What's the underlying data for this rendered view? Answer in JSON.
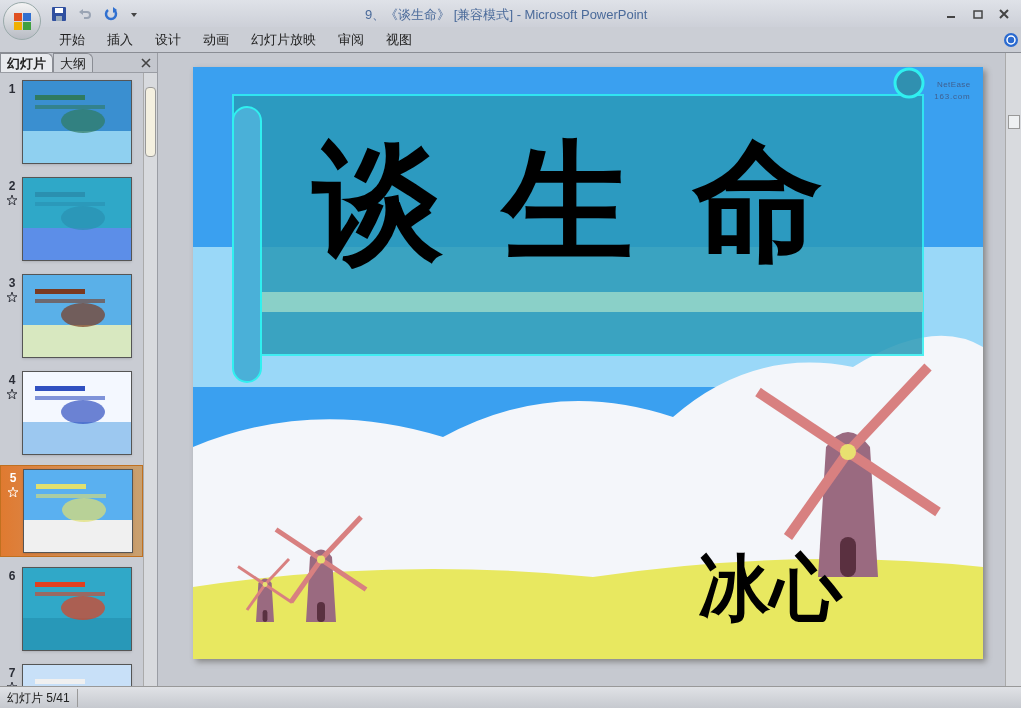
{
  "window": {
    "title": "9、《谈生命》 [兼容模式] - Microsoft PowerPoint"
  },
  "ribbon_tabs": [
    {
      "label": "开始"
    },
    {
      "label": "插入"
    },
    {
      "label": "设计"
    },
    {
      "label": "动画"
    },
    {
      "label": "幻灯片放映"
    },
    {
      "label": "审阅"
    },
    {
      "label": "视图"
    }
  ],
  "panel_tabs": [
    {
      "label": "幻灯片",
      "selected": true
    },
    {
      "label": "大纲",
      "selected": false
    }
  ],
  "slides": [
    {
      "number": "1",
      "animated": false,
      "selected": false,
      "kind": "picture"
    },
    {
      "number": "2",
      "animated": true,
      "selected": false,
      "kind": "picture"
    },
    {
      "number": "3",
      "animated": true,
      "selected": false,
      "kind": "picture"
    },
    {
      "number": "4",
      "animated": true,
      "selected": false,
      "kind": "picture"
    },
    {
      "number": "5",
      "animated": true,
      "selected": true,
      "kind": "picture"
    },
    {
      "number": "6",
      "animated": false,
      "selected": false,
      "kind": "picture"
    },
    {
      "number": "7",
      "animated": true,
      "selected": false,
      "kind": "picture"
    }
  ],
  "slide": {
    "title": "谈生命",
    "author": "冰心",
    "logo_name": "NetEase",
    "logo_site": "163.com"
  },
  "status_bar": {
    "slide_count": "幻灯片 5/41"
  }
}
